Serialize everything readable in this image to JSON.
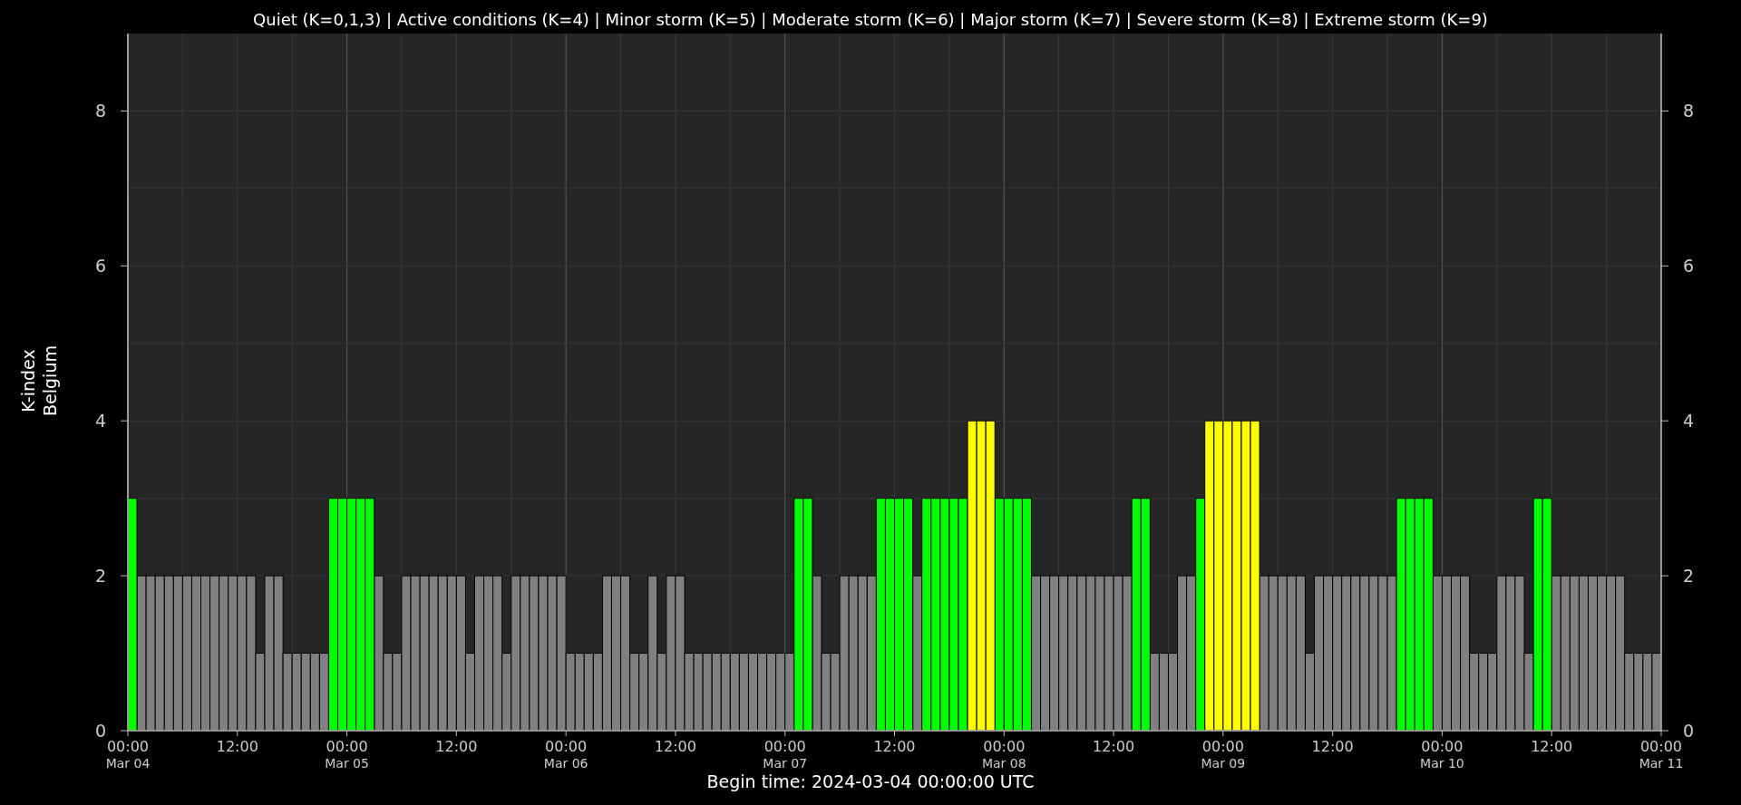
{
  "chart_data": {
    "type": "bar",
    "title": "Quiet (K=0,1,3) | Active conditions (K=4) | Minor storm (K=5) | Moderate storm (K=6) | Major storm (K=7) | Severe storm (K=8) | Extreme storm (K=9)",
    "xlabel": "Begin time: 2024-03-04 00:00:00 UTC",
    "ylabel": "K-index\nBelgium",
    "xlim": [
      "2024-03-04T00:00Z",
      "2024-03-11T00:00Z"
    ],
    "ylim": [
      0,
      9
    ],
    "grid": true,
    "yticks": [
      0,
      2,
      4,
      6,
      8
    ],
    "xticks": [
      {
        "value": "2024-03-04T00:00Z",
        "label": "00:00\nMar 04"
      },
      {
        "value": "2024-03-04T12:00Z",
        "label": "12:00"
      },
      {
        "value": "2024-03-05T00:00Z",
        "label": "00:00\nMar 05"
      },
      {
        "value": "2024-03-05T12:00Z",
        "label": "12:00"
      },
      {
        "value": "2024-03-06T00:00Z",
        "label": "00:00\nMar 06"
      },
      {
        "value": "2024-03-06T12:00Z",
        "label": "12:00"
      },
      {
        "value": "2024-03-07T00:00Z",
        "label": "00:00\nMar 07"
      },
      {
        "value": "2024-03-07T12:00Z",
        "label": "12:00"
      },
      {
        "value": "2024-03-08T00:00Z",
        "label": "00:00\nMar 08"
      },
      {
        "value": "2024-03-08T12:00Z",
        "label": "12:00"
      },
      {
        "value": "2024-03-09T00:00Z",
        "label": "00:00\nMar 09"
      },
      {
        "value": "2024-03-09T12:00Z",
        "label": "12:00"
      },
      {
        "value": "2024-03-10T00:00Z",
        "label": "00:00\nMar 10"
      },
      {
        "value": "2024-03-10T12:00Z",
        "label": "12:00"
      },
      {
        "value": "2024-03-11T00:00Z",
        "label": "00:00\nMar 11"
      }
    ],
    "x": [
      "2024-03-04T00:00Z",
      "2024-03-04T01:00Z",
      "2024-03-04T02:00Z",
      "2024-03-04T03:00Z",
      "2024-03-04T04:00Z",
      "2024-03-04T05:00Z",
      "2024-03-04T06:00Z",
      "2024-03-04T07:00Z",
      "2024-03-04T08:00Z",
      "2024-03-04T09:00Z",
      "2024-03-04T10:00Z",
      "2024-03-04T11:00Z",
      "2024-03-04T12:00Z",
      "2024-03-04T13:00Z",
      "2024-03-04T14:00Z",
      "2024-03-04T15:00Z",
      "2024-03-04T16:00Z",
      "2024-03-04T17:00Z",
      "2024-03-04T18:00Z",
      "2024-03-04T19:00Z",
      "2024-03-04T20:00Z",
      "2024-03-04T21:00Z",
      "2024-03-04T22:00Z",
      "2024-03-04T23:00Z",
      "2024-03-05T00:00Z",
      "2024-03-05T01:00Z",
      "2024-03-05T02:00Z",
      "2024-03-05T03:00Z",
      "2024-03-05T04:00Z",
      "2024-03-05T05:00Z",
      "2024-03-05T06:00Z",
      "2024-03-05T07:00Z",
      "2024-03-05T08:00Z",
      "2024-03-05T09:00Z",
      "2024-03-05T10:00Z",
      "2024-03-05T11:00Z",
      "2024-03-05T12:00Z",
      "2024-03-05T13:00Z",
      "2024-03-05T14:00Z",
      "2024-03-05T15:00Z",
      "2024-03-05T16:00Z",
      "2024-03-05T17:00Z",
      "2024-03-05T18:00Z",
      "2024-03-05T19:00Z",
      "2024-03-05T20:00Z",
      "2024-03-05T21:00Z",
      "2024-03-05T22:00Z",
      "2024-03-05T23:00Z",
      "2024-03-06T00:00Z",
      "2024-03-06T01:00Z",
      "2024-03-06T02:00Z",
      "2024-03-06T03:00Z",
      "2024-03-06T04:00Z",
      "2024-03-06T05:00Z",
      "2024-03-06T06:00Z",
      "2024-03-06T07:00Z",
      "2024-03-06T08:00Z",
      "2024-03-06T09:00Z",
      "2024-03-06T10:00Z",
      "2024-03-06T11:00Z",
      "2024-03-06T12:00Z",
      "2024-03-06T13:00Z",
      "2024-03-06T14:00Z",
      "2024-03-06T15:00Z",
      "2024-03-06T16:00Z",
      "2024-03-06T17:00Z",
      "2024-03-06T18:00Z",
      "2024-03-06T19:00Z",
      "2024-03-06T20:00Z",
      "2024-03-06T21:00Z",
      "2024-03-06T22:00Z",
      "2024-03-06T23:00Z",
      "2024-03-07T00:00Z",
      "2024-03-07T01:00Z",
      "2024-03-07T02:00Z",
      "2024-03-07T03:00Z",
      "2024-03-07T04:00Z",
      "2024-03-07T05:00Z",
      "2024-03-07T06:00Z",
      "2024-03-07T07:00Z",
      "2024-03-07T08:00Z",
      "2024-03-07T09:00Z",
      "2024-03-07T10:00Z",
      "2024-03-07T11:00Z",
      "2024-03-07T12:00Z",
      "2024-03-07T13:00Z",
      "2024-03-07T14:00Z",
      "2024-03-07T15:00Z",
      "2024-03-07T16:00Z",
      "2024-03-07T17:00Z",
      "2024-03-07T18:00Z",
      "2024-03-07T19:00Z",
      "2024-03-07T20:00Z",
      "2024-03-07T21:00Z",
      "2024-03-07T22:00Z",
      "2024-03-07T23:00Z",
      "2024-03-08T00:00Z",
      "2024-03-08T01:00Z",
      "2024-03-08T02:00Z",
      "2024-03-08T03:00Z",
      "2024-03-08T04:00Z",
      "2024-03-08T05:00Z",
      "2024-03-08T06:00Z",
      "2024-03-08T07:00Z",
      "2024-03-08T08:00Z",
      "2024-03-08T09:00Z",
      "2024-03-08T10:00Z",
      "2024-03-08T11:00Z",
      "2024-03-08T12:00Z",
      "2024-03-08T13:00Z",
      "2024-03-08T14:00Z",
      "2024-03-08T15:00Z",
      "2024-03-08T16:00Z",
      "2024-03-08T17:00Z",
      "2024-03-08T18:00Z",
      "2024-03-08T19:00Z",
      "2024-03-08T20:00Z",
      "2024-03-08T21:00Z",
      "2024-03-08T22:00Z",
      "2024-03-08T23:00Z",
      "2024-03-09T00:00Z",
      "2024-03-09T01:00Z",
      "2024-03-09T02:00Z",
      "2024-03-09T03:00Z",
      "2024-03-09T04:00Z",
      "2024-03-09T05:00Z",
      "2024-03-09T06:00Z",
      "2024-03-09T07:00Z",
      "2024-03-09T08:00Z",
      "2024-03-09T09:00Z",
      "2024-03-09T10:00Z",
      "2024-03-09T11:00Z",
      "2024-03-09T12:00Z",
      "2024-03-09T13:00Z",
      "2024-03-09T14:00Z",
      "2024-03-09T15:00Z",
      "2024-03-09T16:00Z",
      "2024-03-09T17:00Z",
      "2024-03-09T18:00Z",
      "2024-03-09T19:00Z",
      "2024-03-09T20:00Z",
      "2024-03-09T21:00Z",
      "2024-03-09T22:00Z",
      "2024-03-09T23:00Z",
      "2024-03-10T00:00Z",
      "2024-03-10T01:00Z",
      "2024-03-10T02:00Z",
      "2024-03-10T03:00Z",
      "2024-03-10T04:00Z",
      "2024-03-10T05:00Z",
      "2024-03-10T06:00Z",
      "2024-03-10T07:00Z",
      "2024-03-10T08:00Z",
      "2024-03-10T09:00Z",
      "2024-03-10T10:00Z",
      "2024-03-10T11:00Z",
      "2024-03-10T12:00Z",
      "2024-03-10T13:00Z",
      "2024-03-10T14:00Z",
      "2024-03-10T15:00Z",
      "2024-03-10T16:00Z",
      "2024-03-10T17:00Z",
      "2024-03-10T18:00Z",
      "2024-03-10T19:00Z",
      "2024-03-10T20:00Z",
      "2024-03-10T21:00Z",
      "2024-03-10T22:00Z",
      "2024-03-10T23:00Z"
    ],
    "series": [
      {
        "color": "#808080",
        "values": [
          null,
          2,
          2,
          2,
          2,
          2,
          2,
          2,
          2,
          2,
          2,
          2,
          2,
          2,
          1,
          2,
          2,
          1,
          1,
          1,
          1,
          1,
          null,
          null,
          null,
          null,
          null,
          2,
          1,
          1,
          2,
          2,
          2,
          2,
          2,
          2,
          2,
          1,
          2,
          2,
          2,
          1,
          2,
          2,
          2,
          2,
          2,
          2,
          1,
          1,
          1,
          1,
          2,
          2,
          2,
          1,
          1,
          2,
          1,
          2,
          2,
          1,
          1,
          1,
          1,
          1,
          1,
          1,
          1,
          1,
          1,
          1,
          1,
          null,
          null,
          2,
          1,
          1,
          2,
          2,
          2,
          2,
          null,
          null,
          null,
          null,
          2,
          null,
          null,
          null,
          null,
          null,
          null,
          null,
          null,
          null,
          null,
          null,
          null,
          2,
          2,
          2,
          2,
          2,
          2,
          2,
          2,
          2,
          2,
          2,
          null,
          null,
          1,
          1,
          1,
          2,
          2,
          null,
          null,
          null,
          null,
          null,
          null,
          null,
          2,
          2,
          2,
          2,
          2,
          1,
          2,
          2,
          2,
          2,
          2,
          2,
          2,
          2,
          2,
          null,
          null,
          null,
          null,
          2,
          2,
          2,
          2,
          1,
          1,
          1,
          2,
          2,
          2,
          1,
          null,
          null,
          2,
          2,
          2,
          2,
          2,
          2,
          2,
          2,
          1,
          1,
          1,
          1
        ]
      },
      {
        "color": "#00ff00",
        "values": [
          3,
          null,
          null,
          null,
          null,
          null,
          null,
          null,
          null,
          null,
          null,
          null,
          null,
          null,
          null,
          null,
          null,
          null,
          null,
          null,
          null,
          null,
          3,
          3,
          3,
          3,
          3,
          null,
          null,
          null,
          null,
          null,
          null,
          null,
          null,
          null,
          null,
          null,
          null,
          null,
          null,
          null,
          null,
          null,
          null,
          null,
          null,
          null,
          null,
          null,
          null,
          null,
          null,
          null,
          null,
          null,
          null,
          null,
          null,
          null,
          null,
          null,
          null,
          null,
          null,
          null,
          null,
          null,
          null,
          null,
          null,
          null,
          null,
          3,
          3,
          null,
          null,
          null,
          null,
          null,
          null,
          null,
          3,
          3,
          3,
          3,
          null,
          3,
          3,
          3,
          3,
          3,
          null,
          null,
          null,
          3,
          3,
          3,
          3,
          null,
          null,
          null,
          null,
          null,
          null,
          null,
          null,
          null,
          null,
          null,
          3,
          3,
          null,
          null,
          null,
          null,
          null,
          3,
          null,
          null,
          null,
          null,
          null,
          null,
          null,
          null,
          null,
          null,
          null,
          null,
          null,
          null,
          null,
          null,
          null,
          null,
          null,
          null,
          null,
          3,
          3,
          3,
          3,
          null,
          null,
          null,
          null,
          null,
          null,
          null,
          null,
          null,
          null,
          null,
          3,
          3,
          null,
          null,
          null,
          null,
          null,
          null,
          null,
          null,
          null,
          null,
          null,
          null
        ]
      },
      {
        "color": "#ffff00",
        "values": [
          null,
          null,
          null,
          null,
          null,
          null,
          null,
          null,
          null,
          null,
          null,
          null,
          null,
          null,
          null,
          null,
          null,
          null,
          null,
          null,
          null,
          null,
          null,
          null,
          null,
          null,
          null,
          null,
          null,
          null,
          null,
          null,
          null,
          null,
          null,
          null,
          null,
          null,
          null,
          null,
          null,
          null,
          null,
          null,
          null,
          null,
          null,
          null,
          null,
          null,
          null,
          null,
          null,
          null,
          null,
          null,
          null,
          null,
          null,
          null,
          null,
          null,
          null,
          null,
          null,
          null,
          null,
          null,
          null,
          null,
          null,
          null,
          null,
          null,
          null,
          null,
          null,
          null,
          null,
          null,
          null,
          null,
          null,
          null,
          null,
          null,
          null,
          null,
          null,
          null,
          null,
          null,
          4,
          4,
          4,
          null,
          null,
          null,
          null,
          null,
          null,
          null,
          null,
          null,
          null,
          null,
          null,
          null,
          null,
          null,
          null,
          null,
          null,
          null,
          null,
          null,
          null,
          null,
          4,
          4,
          4,
          4,
          4,
          4,
          null,
          null,
          null,
          null,
          null,
          null,
          null,
          null,
          null,
          null,
          null,
          null,
          null,
          null,
          null,
          null,
          null,
          null,
          null,
          null,
          null,
          null,
          null,
          null,
          null,
          null,
          null,
          null,
          null,
          null,
          null,
          null,
          null,
          null,
          null,
          null,
          null,
          null,
          null,
          null,
          null,
          null,
          null,
          null
        ]
      }
    ]
  },
  "right_axis": {
    "ticks": [
      "8",
      "6",
      "4",
      "2",
      "0"
    ]
  }
}
